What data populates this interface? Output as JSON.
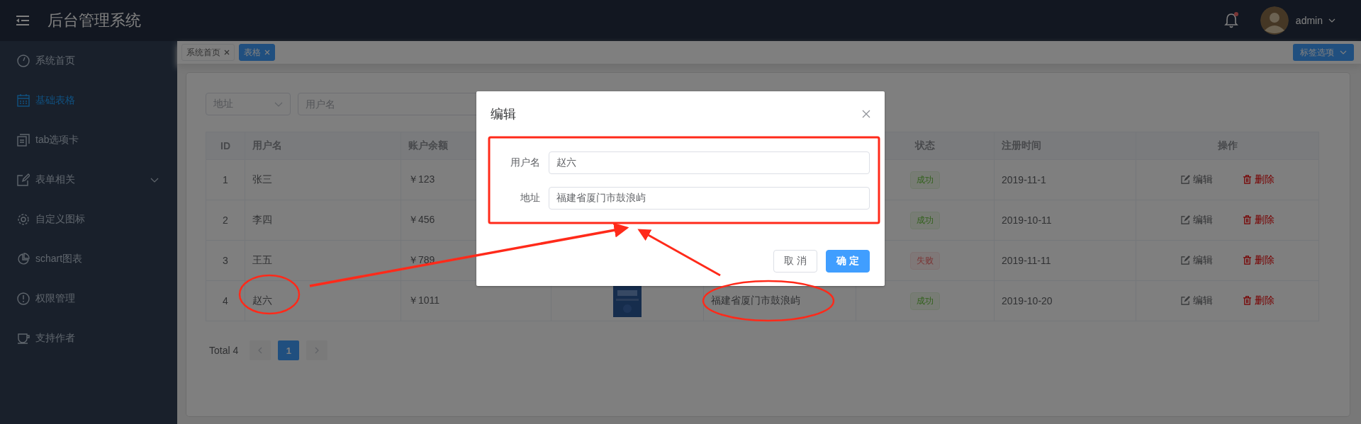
{
  "header": {
    "title": "后台管理系统",
    "notification_dot": true,
    "user": "admin"
  },
  "sidebar": {
    "items": [
      {
        "label": "系统首页",
        "selected": false,
        "kind": "item"
      },
      {
        "label": "基础表格",
        "selected": true,
        "kind": "item"
      },
      {
        "label": "tab选项卡",
        "selected": false,
        "kind": "item"
      },
      {
        "label": "表单相关",
        "selected": false,
        "kind": "submenu"
      },
      {
        "label": "自定义图标",
        "selected": false,
        "kind": "item"
      },
      {
        "label": "schart图表",
        "selected": false,
        "kind": "item"
      },
      {
        "label": "权限管理",
        "selected": false,
        "kind": "item"
      },
      {
        "label": "支持作者",
        "selected": false,
        "kind": "item"
      }
    ]
  },
  "tags": {
    "items": [
      {
        "label": "系统首页",
        "selected": false
      },
      {
        "label": "表格",
        "selected": true
      }
    ],
    "options_button": "标签选项"
  },
  "filters": {
    "select": {
      "placeholder": "地址"
    },
    "search": {
      "placeholder": "用户名"
    }
  },
  "table": {
    "columns": [
      {
        "label": "ID"
      },
      {
        "label": "用户名"
      },
      {
        "label": "账户余额"
      },
      {},
      {},
      {
        "label": "状态"
      },
      {
        "label": "注册时间"
      },
      {
        "label": "操作"
      }
    ],
    "rows": [
      {
        "id": "1",
        "name": "张三",
        "balance": "￥123",
        "status": {
          "text": "成功",
          "kind": "success"
        },
        "date": "2019-11-1",
        "actions": [
          "编辑",
          "删除"
        ]
      },
      {
        "id": "2",
        "name": "李四",
        "balance": "￥456",
        "status": {
          "text": "成功",
          "kind": "success"
        },
        "date": "2019-10-11",
        "actions": [
          "编辑",
          "删除"
        ]
      },
      {
        "id": "3",
        "name": "王五",
        "balance": "￥789",
        "status": {
          "text": "失败",
          "kind": "fail"
        },
        "date": "2019-11-11",
        "actions": [
          "编辑",
          "删除"
        ]
      },
      {
        "id": "4",
        "name": "赵六",
        "balance": "￥1011",
        "address": "福建省厦门市鼓浪屿",
        "status": {
          "text": "成功",
          "kind": "success"
        },
        "date": "2019-10-20",
        "actions": [
          "编辑",
          "删除"
        ]
      }
    ]
  },
  "pagination": {
    "total": "Total 4",
    "pages": [
      {
        "label": "1",
        "selected": true
      }
    ]
  },
  "dialog": {
    "title": "编辑",
    "fields": [
      {
        "label": "用户名",
        "value": "赵六"
      },
      {
        "label": "地址",
        "value": "福建省厦门市鼓浪屿"
      }
    ],
    "buttons": [
      {
        "label": "取 消",
        "kind": "default"
      },
      {
        "label": "确 定",
        "kind": "primary"
      }
    ]
  }
}
